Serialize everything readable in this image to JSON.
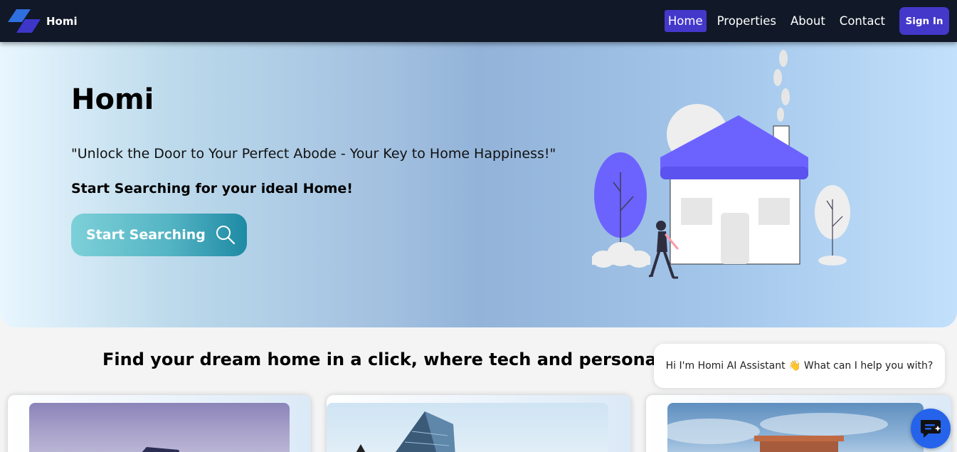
{
  "nav": {
    "brand": "Homi",
    "links": [
      "Home",
      "Properties",
      "About",
      "Contact"
    ],
    "active": "Home",
    "signin": "Sign In"
  },
  "hero": {
    "title": "Homi",
    "tagline": "\"Unlock the Door to Your Perfect Abode - Your Key to Home Happiness!\"",
    "subtitle": "Start Searching for your ideal Home!",
    "search_button": "Start Searching"
  },
  "section": {
    "title": "Find your dream home in a click, where tech and personal servi"
  },
  "chat": {
    "greeting": "Hi I'm Homi AI Assistant 👋 What can I help you with?"
  },
  "colors": {
    "navbar": "#111827",
    "accent": "#4338ca",
    "house_roof": "#6c63ff",
    "chat_button": "#2563eb"
  },
  "icons": [
    "homi-logo-icon",
    "search-icon",
    "chat-icon"
  ]
}
